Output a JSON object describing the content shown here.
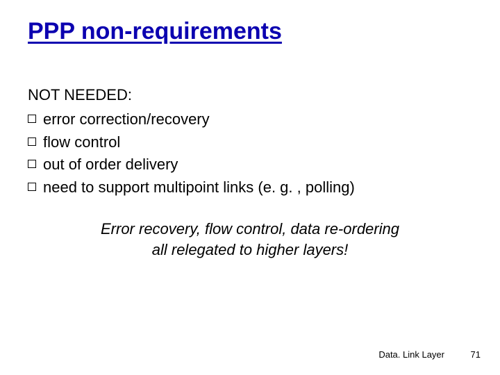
{
  "title": "PPP non-requirements",
  "subhead": "NOT NEEDED:",
  "bullets": [
    "error correction/recovery",
    "flow control",
    "out of order delivery",
    "need to support multipoint links (e. g. , polling)"
  ],
  "summary_line1": "Error recovery, flow control, data re-ordering",
  "summary_line2": "all relegated to higher layers!",
  "footer_label": "Data. Link Layer",
  "footer_number": "71"
}
